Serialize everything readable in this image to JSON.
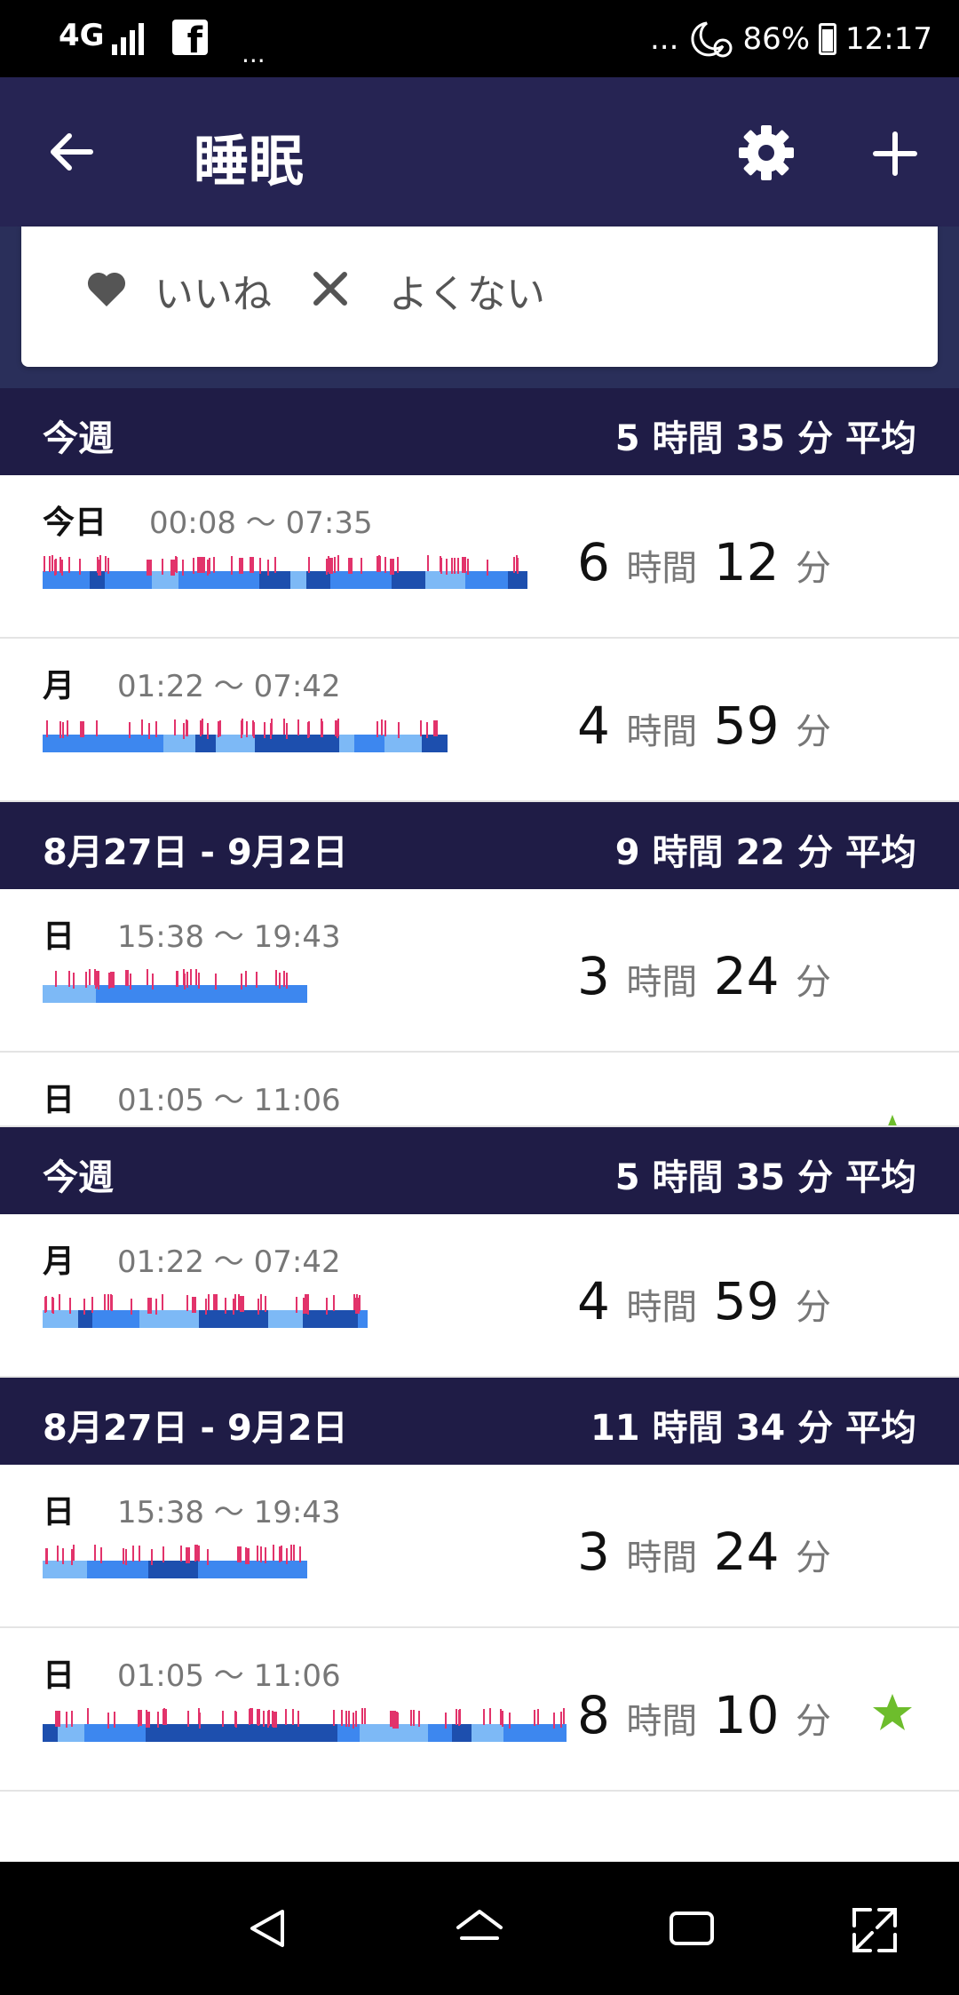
{
  "status_bar": {
    "network": "4G",
    "battery": "86%",
    "time": "12:17",
    "dots_left": "...",
    "dots_right": "..."
  },
  "app_bar": {
    "title": "睡眠"
  },
  "feedback": {
    "like_label": "いいね",
    "dislike_label": "よくない"
  },
  "sections": [
    {
      "label": "今週",
      "average": "5 時間 35 分 平均"
    },
    {
      "label": "8月27日 - 9月2日",
      "average": "9 時間 22 分 平均"
    },
    {
      "label": "今週",
      "average": "5 時間 35 分 平均"
    },
    {
      "label": "8月27日 - 9月2日",
      "average": "11 時間 34 分 平均"
    }
  ],
  "entries": [
    {
      "day": "今日",
      "range": "00:08 〜 07:35",
      "hours": "6",
      "minutes": "12",
      "hour_unit": "時間",
      "minute_unit": "分",
      "goal_star": false
    },
    {
      "day": "月",
      "range": "01:22 〜 07:42",
      "hours": "4",
      "minutes": "59",
      "hour_unit": "時間",
      "minute_unit": "分",
      "goal_star": false
    },
    {
      "day": "日",
      "range": "15:38 〜 19:43",
      "hours": "3",
      "minutes": "24",
      "hour_unit": "時間",
      "minute_unit": "分",
      "goal_star": false
    },
    {
      "day": "日",
      "range": "01:05 〜 11:06",
      "hours": "",
      "minutes": "",
      "hour_unit": "",
      "minute_unit": "",
      "goal_star": false
    },
    {
      "day": "月",
      "range": "01:22 〜 07:42",
      "hours": "4",
      "minutes": "59",
      "hour_unit": "時間",
      "minute_unit": "分",
      "goal_star": false
    },
    {
      "day": "日",
      "range": "15:38 〜 19:43",
      "hours": "3",
      "minutes": "24",
      "hour_unit": "時間",
      "minute_unit": "分",
      "goal_star": false
    },
    {
      "day": "日",
      "range": "01:05 〜 11:06",
      "hours": "8",
      "minutes": "10",
      "hour_unit": "時間",
      "minute_unit": "分",
      "goal_star": true
    }
  ],
  "colors": {
    "header_bg": "#1f1c46",
    "app_bar_bg": "#262453",
    "awake": "#e2336b",
    "deep": "#1d4fae",
    "light": "#3d87ef",
    "rem": "#7db9f6",
    "star": "#6dbd2c"
  },
  "icons": {
    "back": "arrow-left-icon",
    "settings": "gear-icon",
    "add": "plus-icon",
    "like": "heart-icon",
    "dislike": "x-icon",
    "goal": "star-icon"
  }
}
